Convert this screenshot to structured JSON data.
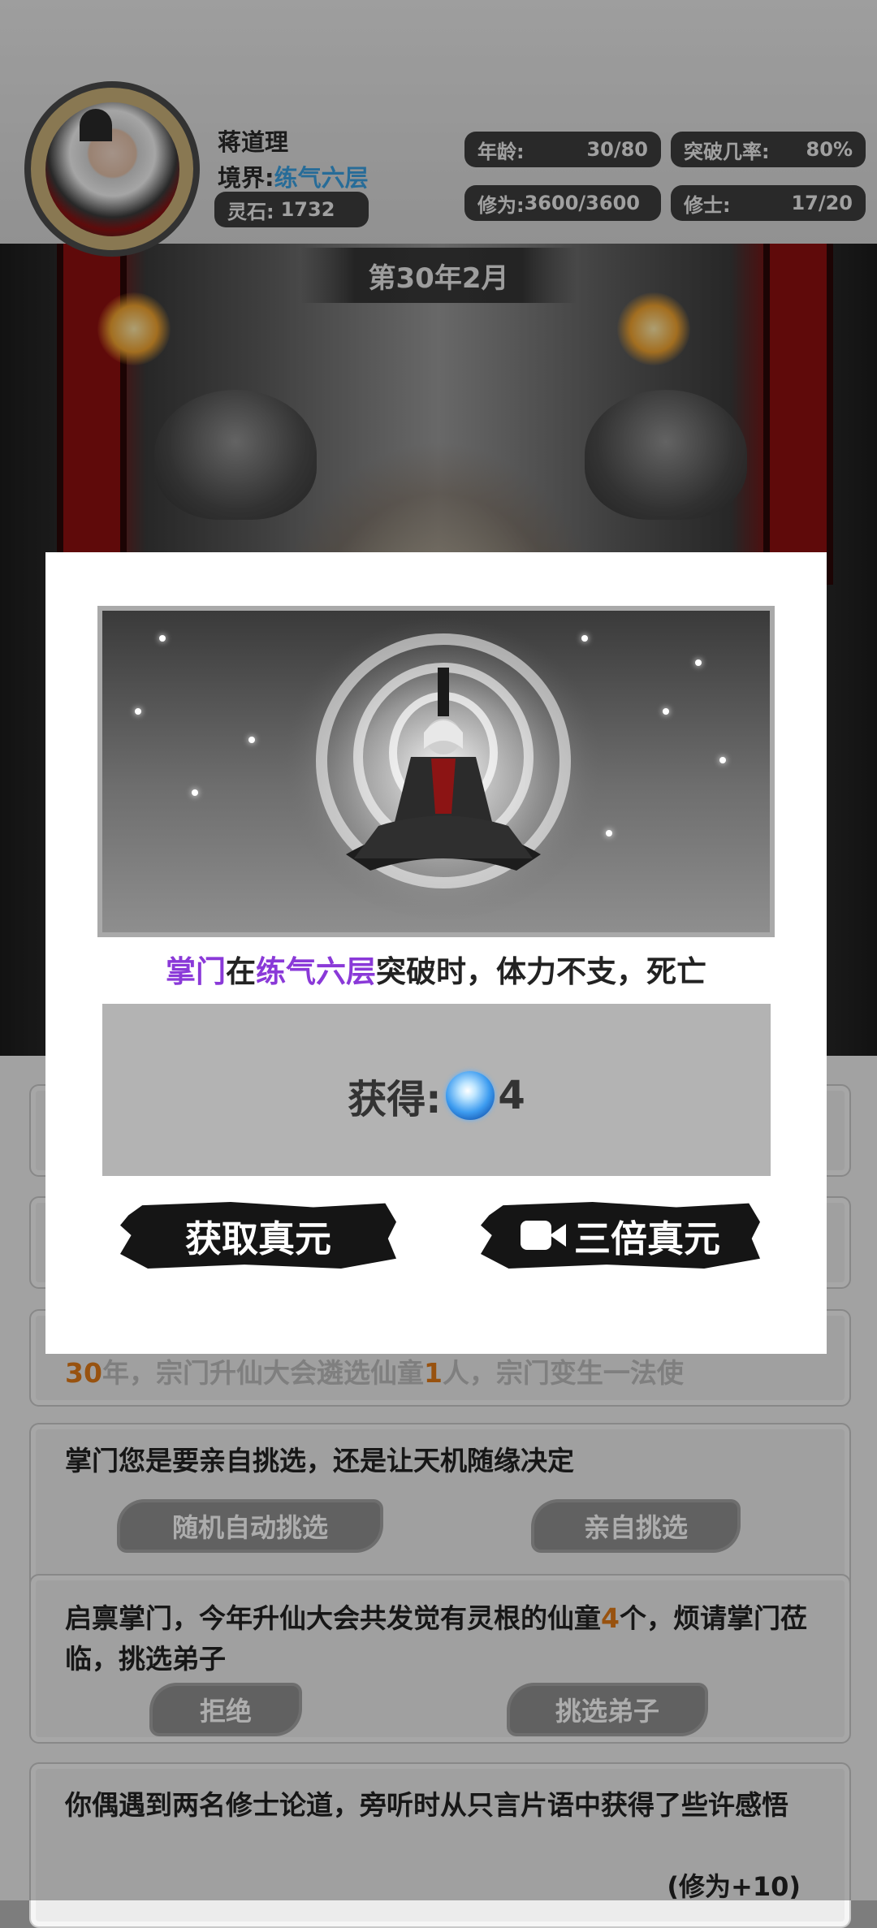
{
  "header": {
    "name": "蒋道理",
    "realm_label": "境界:",
    "realm_value": "练气六层",
    "stone_label": "灵石:",
    "stone_value": "1732",
    "age_label": "年龄:",
    "age_value": "30/80",
    "breakthrough_label": "突破几率:",
    "breakthrough_value": "80%",
    "cultivation_label": "修为:",
    "cultivation_value": "3600/3600",
    "cultivators_label": "修士:",
    "cultivators_value": "17/20"
  },
  "date": "第30年2月",
  "modal": {
    "event": {
      "subject": "掌门",
      "w1": "在",
      "realm": "练气六层",
      "rest": "突破时，体力不支，死亡"
    },
    "reward_label": "获得:",
    "reward_icon": "spirit-orb-icon",
    "reward_value": "4",
    "btn_get": "获取真元",
    "btn_triple": "三倍真元",
    "btn_triple_icon": "video-camera-icon"
  },
  "cards": [
    {
      "year_prefix": "30",
      "text_mid": "年，",
      "tail": "宗门升仙大会遴选仙童",
      "num": "1",
      "tail2": "人，宗门变生一法使"
    },
    {
      "text": "掌门您是要亲自挑选，还是让天机随缘决定",
      "btn_left": "随机自动挑选",
      "btn_right": "亲自挑选"
    },
    {
      "text_a": "启禀掌门，今年升仙大会共发觉有灵根的仙童",
      "num": "4",
      "text_b": "个，烦请掌门莅临，挑选弟子",
      "btn_left": "拒绝",
      "btn_right": "挑选弟子"
    },
    {
      "text": "你偶遇到两名修士论道，旁听时从只言片语中获得了些许感悟",
      "gain": "(修为+10)"
    }
  ],
  "colors": {
    "purple_accent": "#8a39d8",
    "realm_blue": "#3aa0e0",
    "number_orange": "#e07a17"
  }
}
